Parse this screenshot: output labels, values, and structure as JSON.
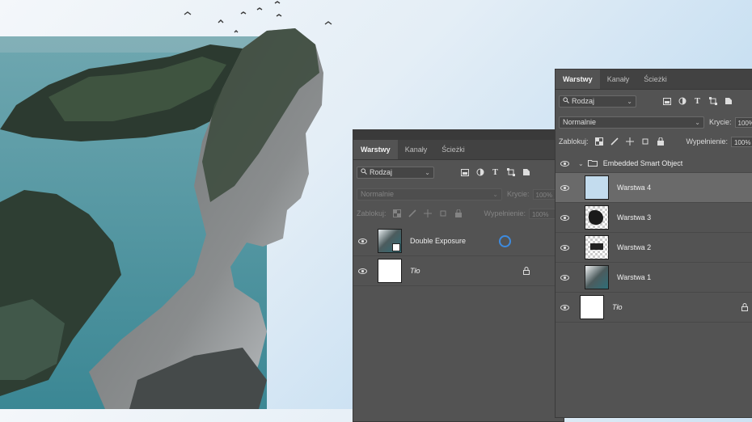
{
  "panel_left": {
    "tabs": [
      "Warstwy",
      "Kanały",
      "Ścieżki"
    ],
    "filter_label": "Rodzaj",
    "blend_mode": "Normalnie",
    "opacity_label": "Krycie:",
    "opacity_value": "100%",
    "lock_label": "Zablokuj:",
    "fill_label": "Wypełnienie:",
    "fill_value": "100%",
    "layers": [
      {
        "name": "Double Exposure"
      },
      {
        "name": "Tło"
      }
    ]
  },
  "panel_right": {
    "tabs": [
      "Warstwy",
      "Kanały",
      "Ścieżki"
    ],
    "filter_label": "Rodzaj",
    "blend_mode": "Normalnie",
    "opacity_label": "Krycie:",
    "opacity_value": "100%",
    "lock_label": "Zablokuj:",
    "fill_label": "Wypełnienie:",
    "fill_value": "100%",
    "group_name": "Embedded Smart Object",
    "layers": [
      {
        "name": "Warstwa 4"
      },
      {
        "name": "Warstwa 3"
      },
      {
        "name": "Warstwa 2"
      },
      {
        "name": "Warstwa 1"
      },
      {
        "name": "Tło"
      }
    ]
  },
  "colors": {
    "panel_bg": "#535353",
    "tab_bar": "#424242",
    "selected_layer": "#6a6a6a",
    "smart_object_badge": "#3d8be0",
    "sea": "#3f8f9c"
  }
}
